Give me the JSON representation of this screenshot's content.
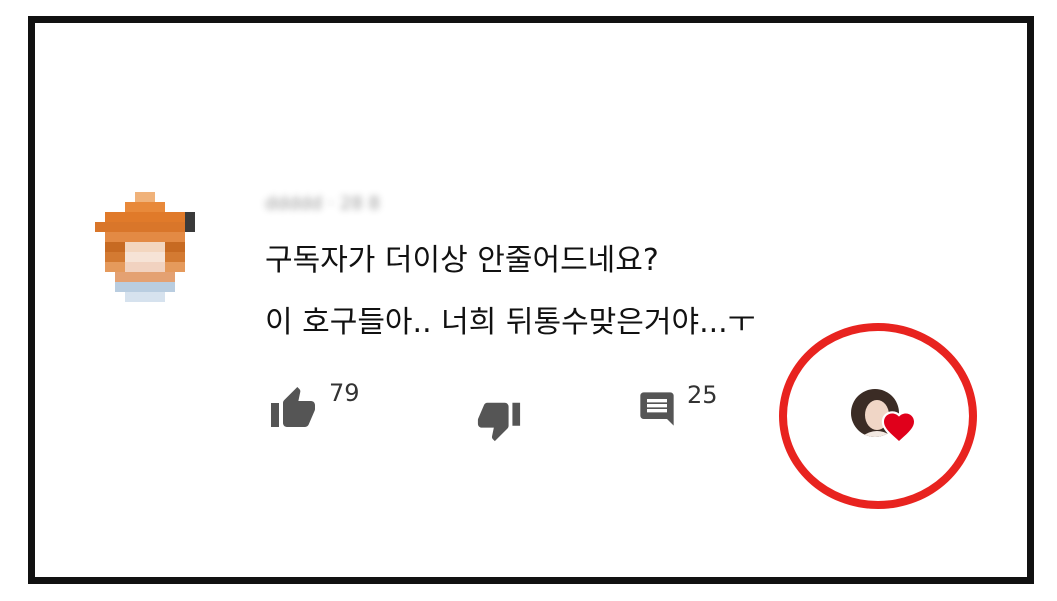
{
  "comment": {
    "author_blurred": "ddddd",
    "time_blurred": "28 8",
    "lines": [
      "구독자가 더이상 안줄어드네요?",
      "이 호구들아.. 너희 뒤통수맞은거야...ㅜ"
    ]
  },
  "actions": {
    "like_count": "79",
    "reply_count": "25"
  },
  "icons": {
    "like": "thumbs-up-icon",
    "dislike": "thumbs-down-icon",
    "reply": "comment-icon",
    "heart": "heart-icon"
  },
  "colors": {
    "annotation": "#e8231f",
    "heart": "#e0001b",
    "icon_gray": "#555555"
  }
}
